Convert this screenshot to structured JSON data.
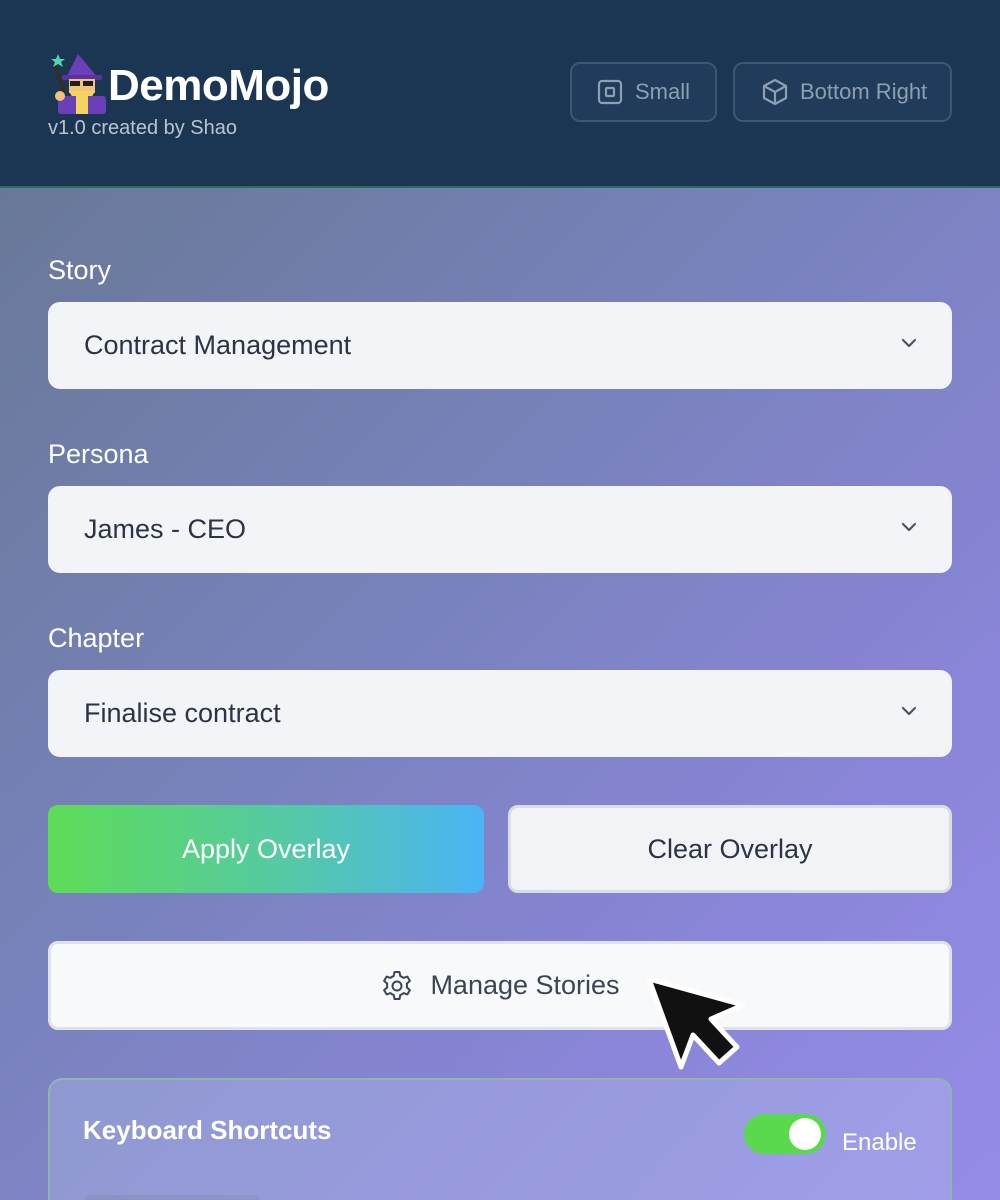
{
  "app": {
    "title": "DemoMojo",
    "subtitle": "v1.0 created by Shao",
    "logo_icon": "wizard-logo-icon"
  },
  "header": {
    "size_button": {
      "label": "Small",
      "icon": "square-icon"
    },
    "position_button": {
      "label": "Bottom Right",
      "icon": "cube-icon"
    }
  },
  "story": {
    "label": "Story",
    "value": "Contract Management"
  },
  "persona": {
    "label": "Persona",
    "value": "James - CEO"
  },
  "chapter": {
    "label": "Chapter",
    "value": "Finalise contract"
  },
  "actions": {
    "apply_label": "Apply Overlay",
    "clear_label": "Clear Overlay",
    "manage_label": "Manage Stories",
    "manage_icon": "gear-icon"
  },
  "shortcuts": {
    "title": "Keyboard Shortcuts",
    "toggle_label": "Enable",
    "enabled": true
  },
  "colors": {
    "header_bg": "#1b3653",
    "apply_gradient_start": "#5edc56",
    "apply_gradient_end": "#4ab4f5",
    "toggle_on": "#5ad94e"
  }
}
